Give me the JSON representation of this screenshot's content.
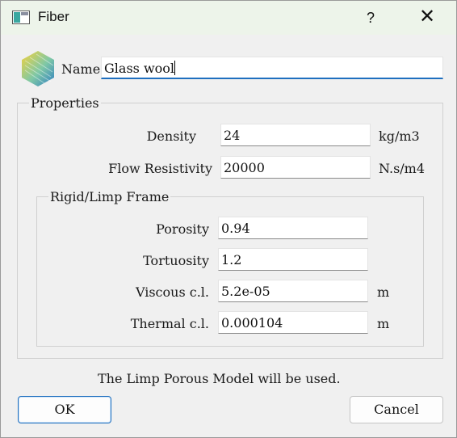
{
  "window": {
    "title": "Fiber",
    "help_label": "?",
    "close_label": "✕"
  },
  "icons": {
    "app": "window-icon",
    "material": "material-hexagon-icon"
  },
  "name": {
    "label": "Name",
    "value": "Glass wool"
  },
  "properties": {
    "title": "Properties",
    "density": {
      "label": "Density",
      "value": "24",
      "unit": "kg/m3"
    },
    "flow_resistivity": {
      "label": "Flow Resistivity",
      "value": "20000",
      "unit": "N.s/m4"
    }
  },
  "frame": {
    "title": "Rigid/Limp Frame",
    "porosity": {
      "label": "Porosity",
      "value": "0.94"
    },
    "tortuosity": {
      "label": "Tortuosity",
      "value": "1.2"
    },
    "viscous": {
      "label": "Viscous c.l.",
      "value": "5.2e-05",
      "unit": "m"
    },
    "thermal": {
      "label": "Thermal c.l.",
      "value": "0.000104",
      "unit": "m"
    }
  },
  "status": "The Limp Porous Model will be used.",
  "buttons": {
    "ok": "OK",
    "cancel": "Cancel"
  },
  "colors": {
    "accent": "#1f6fbf",
    "titlebar": "#edf4ea",
    "background": "#f0f0f0"
  }
}
